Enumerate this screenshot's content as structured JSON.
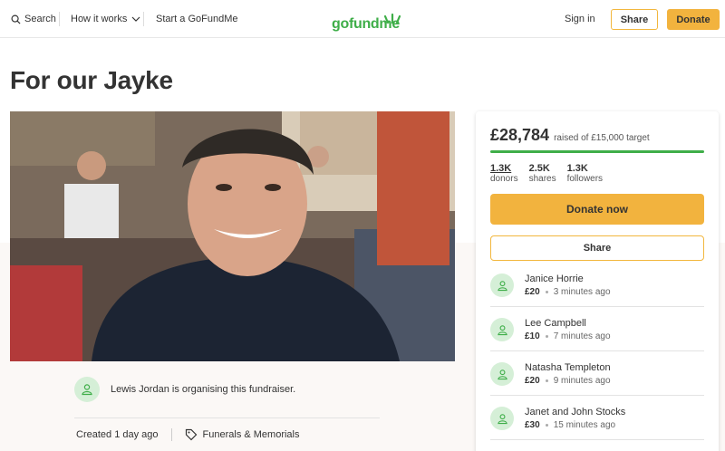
{
  "header": {
    "search_label": "Search",
    "how_label": "How it works",
    "start_label": "Start a GoFundMe",
    "logo_text": "gofundme",
    "signin_label": "Sign in",
    "share_label": "Share",
    "donate_label": "Donate"
  },
  "campaign": {
    "title": "For our Jayke",
    "organiser_text": "Lewis Jordan is organising this fundraiser.",
    "created": "Created 1 day ago",
    "category": "Funerals & Memorials"
  },
  "panel": {
    "amount": "£28,784",
    "target_text": "raised of £15,000 target",
    "progress_fraction": 1.0,
    "stats": [
      {
        "num": "1.3K",
        "label": "donors"
      },
      {
        "num": "2.5K",
        "label": "shares"
      },
      {
        "num": "1.3K",
        "label": "followers"
      }
    ],
    "donate_now_label": "Donate now",
    "share_label": "Share",
    "donations": [
      {
        "name": "Janice Horrie",
        "amount": "£20",
        "time": "3 minutes ago"
      },
      {
        "name": "Lee Campbell",
        "amount": "£10",
        "time": "7 minutes ago"
      },
      {
        "name": "Natasha Templeton",
        "amount": "£20",
        "time": "9 minutes ago"
      },
      {
        "name": "Janet and John Stocks",
        "amount": "£30",
        "time": "15 minutes ago"
      }
    ]
  },
  "colors": {
    "brand_green": "#3fae49",
    "accent_yellow": "#f2b33e",
    "avatar_bg": "#d5efd7"
  }
}
